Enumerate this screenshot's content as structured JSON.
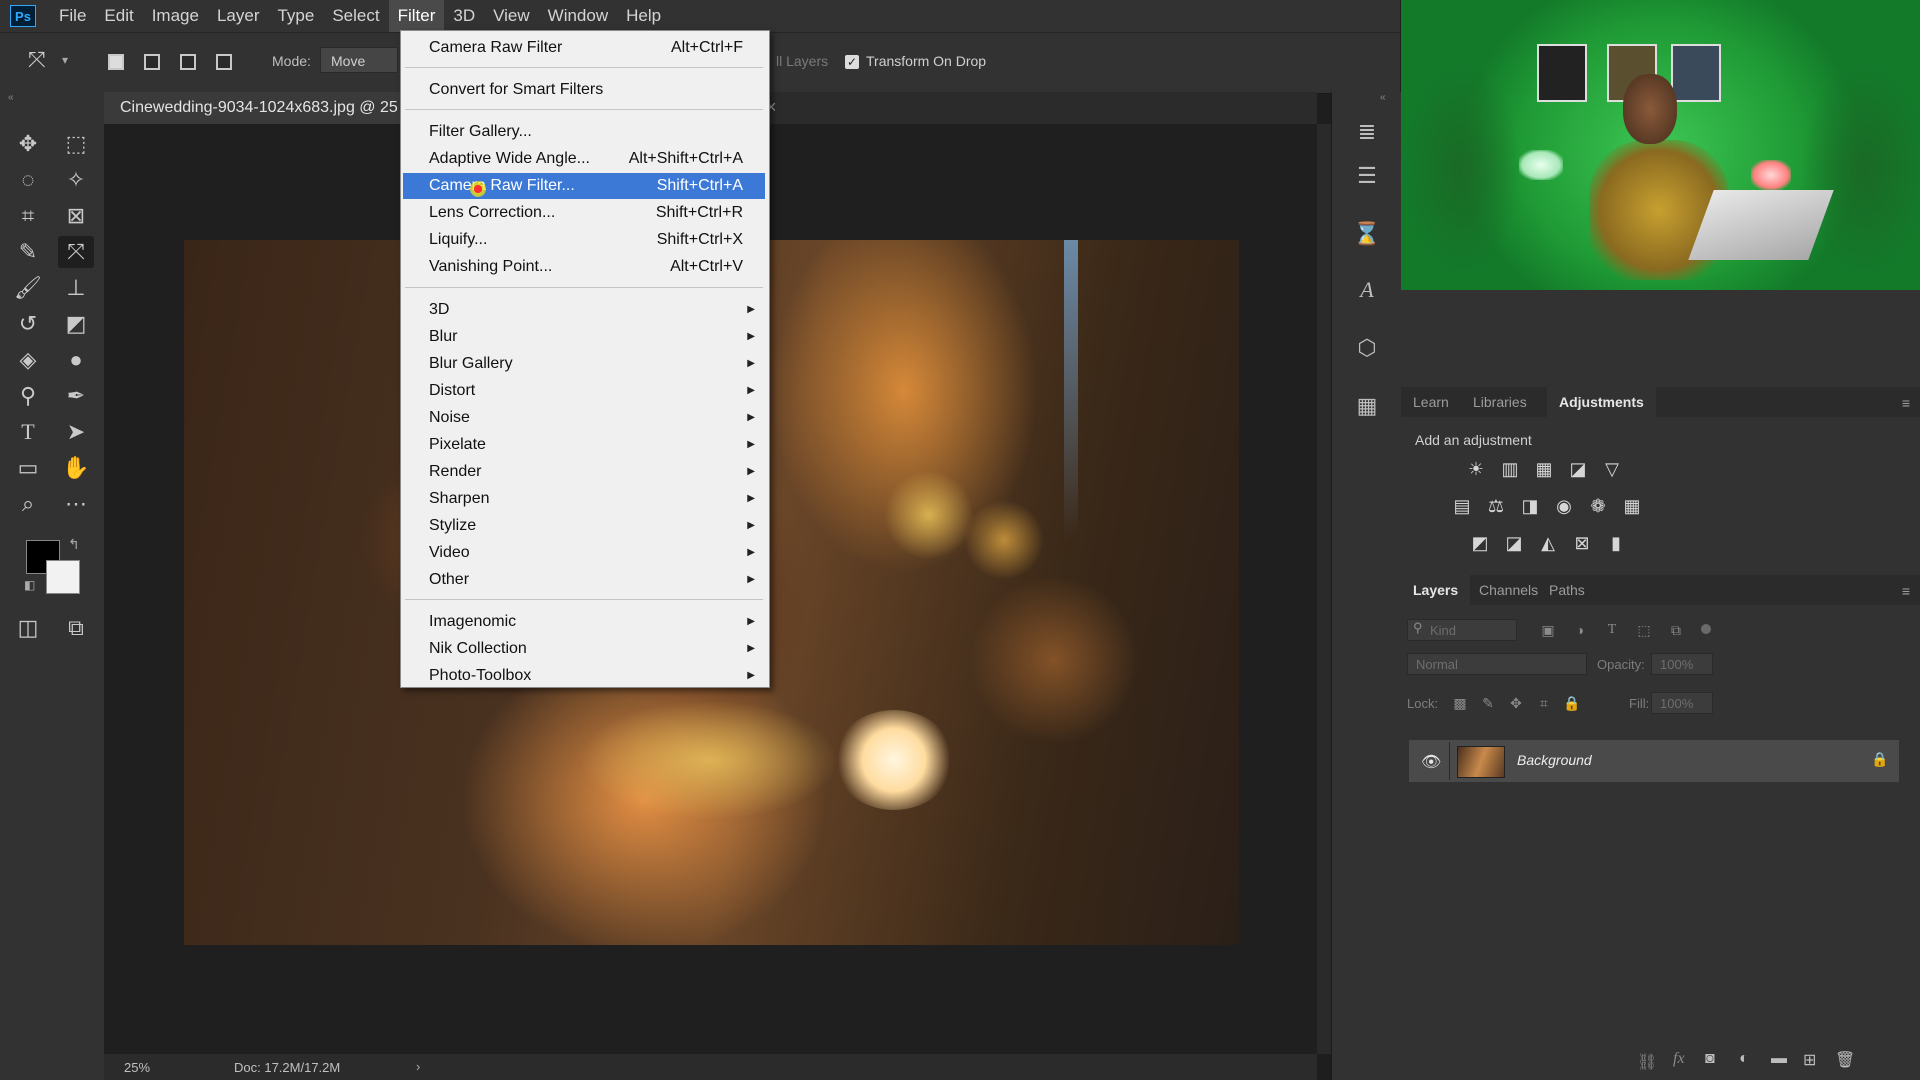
{
  "app": {
    "logo": "Ps"
  },
  "menubar": [
    "File",
    "Edit",
    "Image",
    "Layer",
    "Type",
    "Select",
    "Filter",
    "3D",
    "View",
    "Window",
    "Help"
  ],
  "options": {
    "mode_label": "Mode:",
    "mode_value": "Move",
    "layers_hint": "ll Layers",
    "transform_label": "Transform On Drop"
  },
  "document": {
    "tab_title": "Cinewedding-9034-1024x683.jpg @ 25",
    "zoom": "25%",
    "doc_size": "Doc: 17.2M/17.2M"
  },
  "filter_menu": {
    "top": [
      {
        "label": "Camera Raw Filter",
        "shortcut": "Alt+Ctrl+F"
      }
    ],
    "smart": [
      {
        "label": "Convert for Smart Filters",
        "shortcut": ""
      }
    ],
    "filters": [
      {
        "label": "Filter Gallery...",
        "shortcut": ""
      },
      {
        "label": "Adaptive Wide Angle...",
        "shortcut": "Alt+Shift+Ctrl+A"
      },
      {
        "label": "Camera Raw Filter...",
        "shortcut": "Shift+Ctrl+A"
      },
      {
        "label": "Lens Correction...",
        "shortcut": "Shift+Ctrl+R"
      },
      {
        "label": "Liquify...",
        "shortcut": "Shift+Ctrl+X"
      },
      {
        "label": "Vanishing Point...",
        "shortcut": "Alt+Ctrl+V"
      }
    ],
    "submenus": [
      "3D",
      "Blur",
      "Blur Gallery",
      "Distort",
      "Noise",
      "Pixelate",
      "Render",
      "Sharpen",
      "Stylize",
      "Video",
      "Other"
    ],
    "plugins": [
      "Imagenomic",
      "Nik Collection",
      "Photo-Toolbox"
    ]
  },
  "adjust_panel": {
    "tabs": [
      "Learn",
      "Libraries",
      "Adjustments"
    ],
    "heading": "Add an adjustment"
  },
  "layers_panel": {
    "tabs": [
      "Layers",
      "Channels",
      "Paths"
    ],
    "kind_placeholder": "Kind",
    "blend_mode": "Normal",
    "opacity_label": "Opacity:",
    "opacity_value": "100%",
    "lock_label": "Lock:",
    "fill_label": "Fill:",
    "fill_value": "100%",
    "layer_name": "Background"
  },
  "colors": {
    "highlight": "#3c79d7",
    "swatches_row1": [
      "#7a2fa0",
      "#a42a9e",
      "#e62f8f",
      "#e8285a",
      "#c62828",
      "#e8622b",
      "#f39a2a",
      "#f2c22a",
      "#e9e22b",
      "#9ccf2b",
      "#3ab54a",
      "#13a15a",
      "#0d9a8e",
      "#1aa0c6",
      "#1e78c0",
      "#2a4fb0",
      "#3a2fa0",
      "#6a2aa0",
      "#a42a7e"
    ],
    "swatches_row2": [
      "#8a1a3a",
      "#8a1a1a",
      "#8a3a1a",
      "#8a5a1a",
      "#8a7a1a",
      "#6a7a1a",
      "#2a6a2a",
      "#1a5a3a",
      "#1a5a5a",
      "#1a4a6a",
      "#1a3a6a",
      "#1a2a5a",
      "#2a1a5a",
      "#4a1a5a",
      "#6a1a4a",
      "#8a1a3a",
      "#d8c8a8",
      "#b89a78"
    ]
  }
}
